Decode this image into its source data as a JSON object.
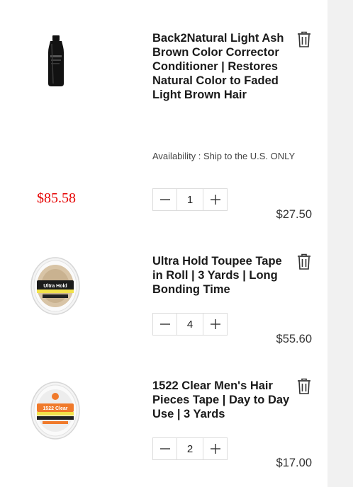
{
  "cart": {
    "items": [
      {
        "title": "Back2Natural Light Ash Brown Color Corrector Conditioner | Restores Natural Color to Faded Light Brown Hair",
        "availability": "Availability : Ship to the U.S. ONLY",
        "sale_price": "$85.58",
        "quantity": "1",
        "price": "$27.50",
        "image": "conditioner-bottle"
      },
      {
        "title": "Ultra Hold Toupee Tape in Roll | 3 Yards | Long Bonding Time",
        "quantity": "4",
        "price": "$55.60",
        "image": "ultra-hold-tape-roll",
        "label_text": "Ultra Hold"
      },
      {
        "title": "1522 Clear Men's Hair Pieces Tape | Day to Day Use | 3 Yards",
        "quantity": "2",
        "price": "$17.00",
        "image": "1522-clear-tape-roll",
        "label_text": "1522 Clear"
      }
    ]
  },
  "icons": {
    "remove": "trash-icon",
    "decrease": "minus-icon",
    "increase": "plus-icon"
  },
  "colors": {
    "sale_price": "#e60000",
    "ultra_hold_band": "#f2e24a",
    "clear_band": "#f07a2b"
  }
}
